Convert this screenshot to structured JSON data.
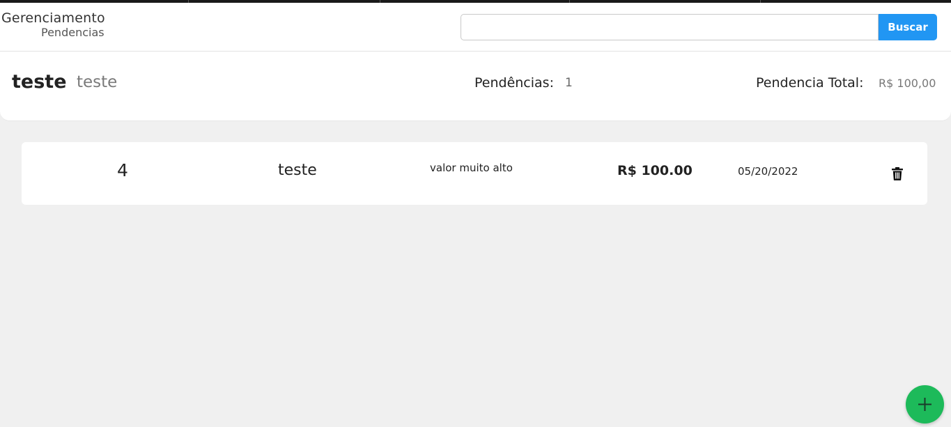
{
  "header": {
    "title": "Gerenciamento",
    "subtitle": "Pendencias",
    "search": {
      "value": "",
      "placeholder": "",
      "button_label": "Buscar"
    }
  },
  "summary": {
    "client_name": "teste",
    "client_sub": "teste",
    "pendencias_label": "Pendências:",
    "pendencias_count": "1",
    "total_label": "Pendencia Total:",
    "total_value": "R$ 100,00"
  },
  "pendencias": [
    {
      "id": "4",
      "name": "teste",
      "description": "valor muito alto",
      "value": "R$ 100.00",
      "date": "05/20/2022",
      "delete_icon": "trash-icon"
    }
  ],
  "fab": {
    "icon": "plus-icon"
  },
  "colors": {
    "accent_blue": "#2196f3",
    "fab_green": "#1dba5a",
    "background": "#f0f0f0",
    "topbar": "#1a1a1a"
  }
}
